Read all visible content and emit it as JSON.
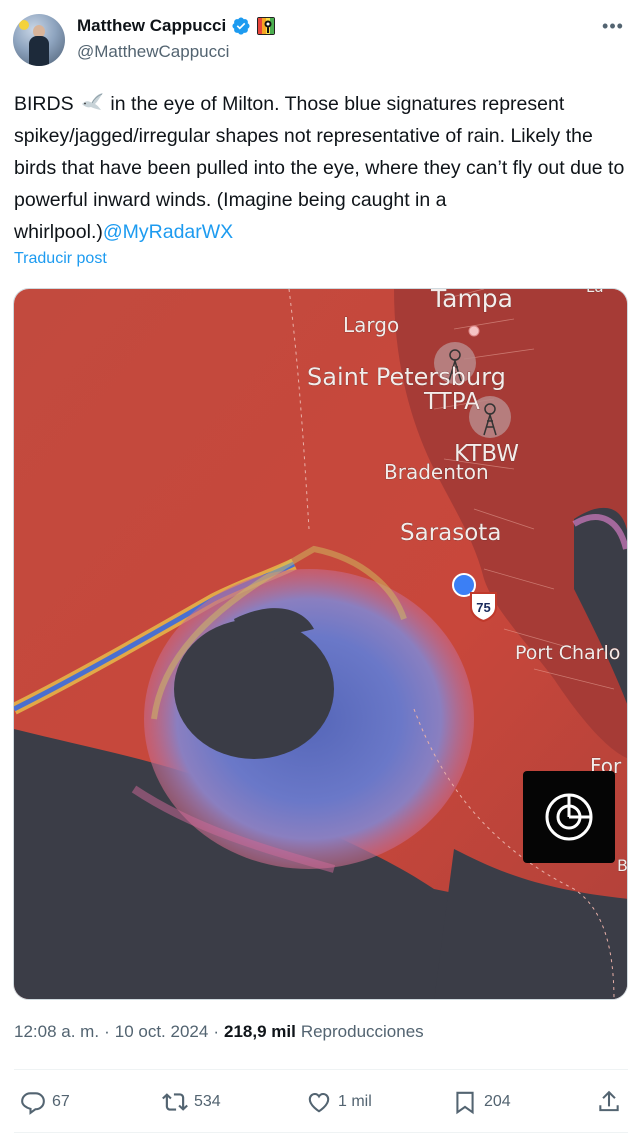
{
  "author": {
    "name": "Matthew Cappucci",
    "handle": "@MatthewCappucci"
  },
  "tweet": {
    "text_before": "BIRDS ",
    "text_after": " in the eye of Milton. Those blue signatures represent spikey/jagged/irregular shapes not representative of rain. Likely the birds that have been pulled into the eye, where they can’t fly out due to powerful inward winds. (Imagine being caught in a whirlpool.)",
    "mention": "@MyRadarWX",
    "translate_label": "Traducir post"
  },
  "map": {
    "labels": {
      "tampa": "Tampa",
      "largo": "Largo",
      "saint_petersburg": "Saint Petersburg",
      "ttpa": "TTPA",
      "ktbw": "KTBW",
      "bradenton": "Bradenton",
      "sarasota": "Sarasota",
      "highway": "75",
      "port_charlotte": "Port Charlo",
      "fort": "For",
      "partial_top": "La",
      "partial_b": "B"
    }
  },
  "meta": {
    "time": "12:08 a. m.",
    "dot": "·",
    "date": "10 oct. 2024",
    "views_count": "218,9 mil",
    "views_label": "Reproducciones"
  },
  "actions": {
    "replies": "67",
    "reposts": "534",
    "likes": "1 mil",
    "bookmarks": "204"
  },
  "colors": {
    "accent": "#1d9bf0",
    "verified": "#1d9bf0",
    "radar_red": "#c9453a",
    "eye_dark": "#3a3c46"
  },
  "icons": [
    "more-icon",
    "verified-icon",
    "flag-icon",
    "bird-emoji-icon",
    "radar-icon",
    "reply-icon",
    "repost-icon",
    "like-icon",
    "bookmark-icon",
    "share-icon"
  ]
}
